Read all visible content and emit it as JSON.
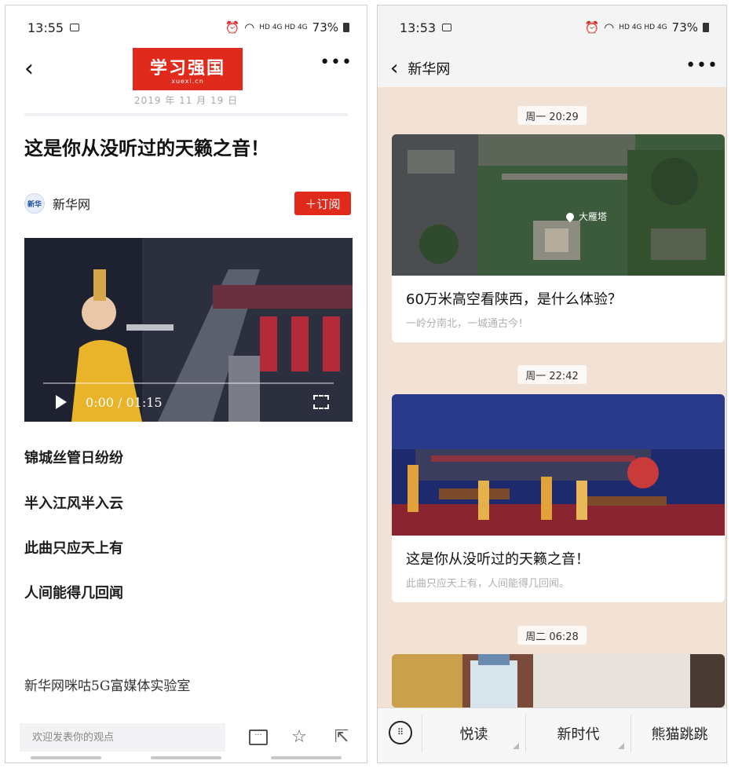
{
  "left": {
    "status": {
      "time": "13:55",
      "signal": "HD 4G HD 4G",
      "battery": "73%"
    },
    "logo": {
      "text": "学习强国",
      "sub": "xuexi.cn"
    },
    "date": "2019 年 11 月 19 日",
    "title": "这是你从没听过的天籁之音！",
    "source": {
      "logo_text": "新华",
      "name": "新华网",
      "subscribe": "＋订阅"
    },
    "video": {
      "time": "0:00 / 01:15",
      "progress": 0
    },
    "poem": [
      "锦城丝管日纷纷",
      "半入江风半入云",
      "此曲只应天上有",
      "人间能得几回闻"
    ],
    "lab": "新华网咪咕5G富媒体实验室",
    "comment_placeholder": "欢迎发表你的观点"
  },
  "right": {
    "status": {
      "time": "13:53",
      "signal": "HD 4G HD 4G",
      "battery": "73%"
    },
    "header_title": "新华网",
    "messages": [
      {
        "time": "周一 20:29",
        "title": "60万米高空看陕西，是什么体验？",
        "subtitle": "一岭分南北，一城通古今！",
        "pin": "大雁塔"
      },
      {
        "time": "周一 22:42",
        "title": "这是你从没听过的天籁之音！",
        "subtitle": "此曲只应天上有，人间能得几回闻。"
      },
      {
        "time": "周二 06:28"
      }
    ],
    "menu": [
      "悦读",
      "新时代",
      "熊猫跳跳"
    ]
  },
  "colors": {
    "brand_red": "#e02a1c",
    "chat_bg": "#f1e2d5"
  }
}
